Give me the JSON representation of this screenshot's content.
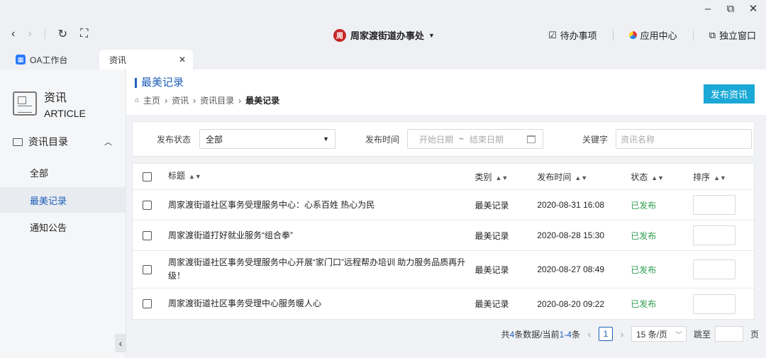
{
  "window": {
    "minimize": "–",
    "restore": "⧉",
    "close": "✕"
  },
  "nav": {
    "back": "‹",
    "forward": "›",
    "refresh": "↻",
    "fullscreen": "⛶"
  },
  "org": {
    "name": "周家渡街道办事处",
    "logo": "周"
  },
  "top_actions": [
    {
      "label": "待办事项"
    },
    {
      "label": "应用中心"
    },
    {
      "label": "独立窗口"
    }
  ],
  "tabs": {
    "oa": "OA工作台",
    "active": "资讯",
    "close": "✕"
  },
  "sidebar": {
    "title_cn": "资讯",
    "title_en": "ARTICLE",
    "group": "资讯目录",
    "items": [
      {
        "label": "全部"
      },
      {
        "label": "最美记录"
      },
      {
        "label": "通知公告"
      }
    ],
    "collapse": "‹"
  },
  "header": {
    "title": "最美记录",
    "breadcrumb": [
      "主页",
      "资讯",
      "资讯目录",
      "最美记录"
    ],
    "publish": "发布资讯"
  },
  "filter": {
    "status_label": "发布状态",
    "status_value": "全部",
    "time_label": "发布时间",
    "start_placeholder": "开始日期",
    "tilde": "~",
    "end_placeholder": "结束日期",
    "keyword_label": "关键字",
    "keyword_placeholder": "资讯名称"
  },
  "table": {
    "columns": [
      "标题",
      "类别",
      "发布时间",
      "状态",
      "排序"
    ],
    "rows": [
      {
        "title": "周家渡街道社区事务受理服务中心：心系百姓 热心为民",
        "type": "最美记录",
        "time": "2020-08-31 16:08",
        "status": "已发布"
      },
      {
        "title": "周家渡街道打好就业服务“组合拳”",
        "type": "最美记录",
        "time": "2020-08-28 15:30",
        "status": "已发布"
      },
      {
        "title": "周家渡街道社区事务受理服务中心开展“家门口”远程帮办培训 助力服务品质再升级！",
        "type": "最美记录",
        "time": "2020-08-27 08:49",
        "status": "已发布"
      },
      {
        "title": "周家渡街道社区事务受理中心服务暖人心",
        "type": "最美记录",
        "time": "2020-08-20 09:22",
        "status": "已发布"
      }
    ]
  },
  "pager": {
    "total_prefix": "共",
    "total": "4",
    "total_mid": "条数据/当前",
    "range": "1-4",
    "total_suffix": "条",
    "page": "1",
    "size": "15 条/页",
    "jump": "跳至",
    "page_unit": "页"
  },
  "colors": {
    "accent": "#1e5fb8",
    "publish_button": "#1aa9d6",
    "status_published": "#2e9d4f"
  }
}
